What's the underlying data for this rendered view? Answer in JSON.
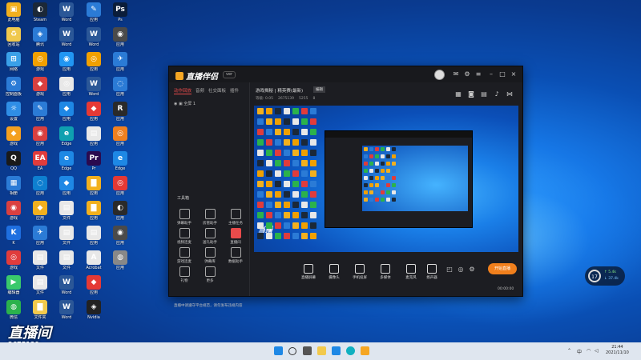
{
  "desktop": {
    "icons": [
      {
        "label": "此电脑",
        "color": "#f2b01e",
        "glyph": "▣"
      },
      {
        "label": "回收站",
        "color": "#f0c94d",
        "glyph": "♻"
      },
      {
        "label": "网络",
        "color": "#3aa0e8",
        "glyph": "⊞"
      },
      {
        "label": "控制面板",
        "color": "#2b7bd6",
        "glyph": "⚙"
      },
      {
        "label": "设置",
        "color": "#2f8ee6",
        "glyph": "☼"
      },
      {
        "label": "游戏",
        "color": "#f4a020",
        "glyph": "◆"
      },
      {
        "label": "QQ",
        "color": "#1a1a1a",
        "glyph": "Q"
      },
      {
        "label": "相册",
        "color": "#2b7bd6",
        "glyph": "▦"
      },
      {
        "label": "游戏",
        "color": "#d94040",
        "glyph": "◉"
      },
      {
        "label": "K",
        "color": "#1e6fe0",
        "glyph": "K"
      },
      {
        "label": "游戏",
        "color": "#e03c3c",
        "glyph": "◎"
      },
      {
        "label": "编辑器",
        "color": "#3ac96b",
        "glyph": "▶"
      },
      {
        "label": "微信",
        "color": "#2bb24c",
        "glyph": "◍"
      },
      {
        "label": "Steam",
        "color": "#1b2838",
        "glyph": "◐"
      },
      {
        "label": "腾讯",
        "color": "#2b7bd6",
        "glyph": "◈"
      },
      {
        "label": "游戏",
        "color": "#f0a000",
        "glyph": "◎"
      },
      {
        "label": "游戏",
        "color": "#d94040",
        "glyph": "◆"
      },
      {
        "label": "应用",
        "color": "#2b7bd6",
        "glyph": "✎"
      },
      {
        "label": "应用",
        "color": "#d94040",
        "glyph": "◉"
      },
      {
        "label": "EA",
        "color": "#e03c3c",
        "glyph": "EA"
      },
      {
        "label": "应用",
        "color": "#0e7fd0",
        "glyph": "◌"
      },
      {
        "label": "应用",
        "color": "#f2b01e",
        "glyph": "◆"
      },
      {
        "label": "应用",
        "color": "#2b7bd6",
        "glyph": "✈"
      },
      {
        "label": "文件",
        "color": "#e8e8e8",
        "glyph": "▤"
      },
      {
        "label": "文件",
        "color": "#e8e8e8",
        "glyph": "▤"
      },
      {
        "label": "文件夹",
        "color": "#f2c94c",
        "glyph": "▇"
      },
      {
        "label": "Word",
        "color": "#2b5797",
        "glyph": "W"
      },
      {
        "label": "Word",
        "color": "#2b5797",
        "glyph": "W"
      },
      {
        "label": "应用",
        "color": "#2196f3",
        "glyph": "◉"
      },
      {
        "label": "应用",
        "color": "#e8e8e8",
        "glyph": "◎"
      },
      {
        "label": "应用",
        "color": "#1e88e5",
        "glyph": "◆"
      },
      {
        "label": "Edge",
        "color": "#0fa0b0",
        "glyph": "e"
      },
      {
        "label": "Edge",
        "color": "#1e88e5",
        "glyph": "e"
      },
      {
        "label": "应用",
        "color": "#1e88e5",
        "glyph": "◆"
      },
      {
        "label": "文件",
        "color": "#e8e8e8",
        "glyph": "▤"
      },
      {
        "label": "文件",
        "color": "#e8e8e8",
        "glyph": "▤"
      },
      {
        "label": "文件",
        "color": "#e8e8e8",
        "glyph": "▤"
      },
      {
        "label": "Word",
        "color": "#2b5797",
        "glyph": "W"
      },
      {
        "label": "Word",
        "color": "#2b5797",
        "glyph": "W"
      },
      {
        "label": "应用",
        "color": "#2b7bd6",
        "glyph": "✎"
      },
      {
        "label": "Word",
        "color": "#2b5797",
        "glyph": "W"
      },
      {
        "label": "应用",
        "color": "#f0a000",
        "glyph": "◎"
      },
      {
        "label": "Word",
        "color": "#2b5797",
        "glyph": "W"
      },
      {
        "label": "应用",
        "color": "#e53935",
        "glyph": "◆"
      },
      {
        "label": "应用",
        "color": "#e8e8e8",
        "glyph": "▤"
      },
      {
        "label": "Pr",
        "color": "#2a0a4f",
        "glyph": "Pr"
      },
      {
        "label": "应用",
        "color": "#f2b01e",
        "glyph": "▇"
      },
      {
        "label": "应用",
        "color": "#f2b01e",
        "glyph": "▇"
      },
      {
        "label": "应用",
        "color": "#e8e8e8",
        "glyph": "▤"
      },
      {
        "label": "Acrobat",
        "color": "#e8e8e8",
        "glyph": "A"
      },
      {
        "label": "应用",
        "color": "#e53935",
        "glyph": "◆"
      },
      {
        "label": "Nvidia",
        "color": "#222",
        "glyph": "◈"
      },
      {
        "label": "Ps",
        "color": "#0b1d3a",
        "glyph": "Ps"
      },
      {
        "label": "应用",
        "color": "#4a4a4a",
        "glyph": "◉"
      },
      {
        "label": "应用",
        "color": "#2b7bd6",
        "glyph": "✈"
      },
      {
        "label": "应用",
        "color": "#2b7bd6",
        "glyph": "◌"
      },
      {
        "label": "应用",
        "color": "#2a2a2a",
        "glyph": "R"
      },
      {
        "label": "应用",
        "color": "#f08020",
        "glyph": "◎"
      },
      {
        "label": "Edge",
        "color": "#1e88e5",
        "glyph": "e"
      },
      {
        "label": "应用",
        "color": "#e53935",
        "glyph": "◎"
      },
      {
        "label": "应用",
        "color": "#2a2a2a",
        "glyph": "◐"
      },
      {
        "label": "应用",
        "color": "#4a4a4a",
        "glyph": "◉"
      },
      {
        "label": "应用",
        "color": "#888",
        "glyph": "◍"
      }
    ]
  },
  "app": {
    "logo_text": "直播伴侣",
    "version_badge": "ver",
    "tabs": [
      "动作回放",
      "音频",
      "社交面板",
      "插件"
    ],
    "scene_label": "全屏 1",
    "tools_title": "工具箱",
    "tools": [
      "弹幕助手",
      "房管助手",
      "主播任务",
      "视频连麦",
      "送礼助手",
      "直播间",
      "游戏连麦",
      "弹幕库",
      "数据助手",
      "礼物",
      "更多"
    ],
    "stream_title": "游戏揭秘 | 精英赛(最新)",
    "edit_label": "编辑",
    "room_info": [
      "等级: 0.05",
      "2675139",
      "5255",
      "8"
    ],
    "controls": [
      "直播屏幕",
      "摄像头",
      "手机投屏",
      "多媒体",
      "麦克风",
      "扬声器"
    ],
    "go_live_label": "开始直播",
    "notice": "直播中请遵守平台规范，请勿发布违规内容",
    "stats": "00:00:00"
  },
  "overlay": {
    "stamp_text": "直播间",
    "room_number": "2675139"
  },
  "widget": {
    "percent": "17",
    "up": "↑ 5.4k",
    "down": "↓ 37.4k"
  },
  "taskbar": {
    "time": "21:44",
    "date": "2021/11/10",
    "lang": "中"
  }
}
